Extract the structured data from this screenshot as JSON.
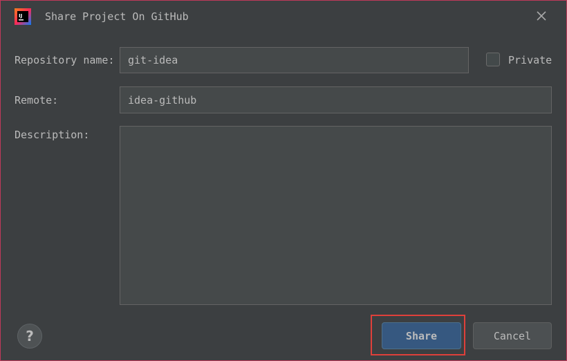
{
  "window": {
    "title": "Share Project On GitHub",
    "app_icon": "intellij-idea-icon",
    "close_icon": "close-icon"
  },
  "form": {
    "repository_name_label": "Repository name:",
    "repository_name_value": "git-idea",
    "private_label": "Private",
    "private_checked": false,
    "remote_label": "Remote:",
    "remote_value": "idea-github",
    "description_label": "Description:",
    "description_value": ""
  },
  "footer": {
    "help_label": "?",
    "share_label": "Share",
    "cancel_label": "Cancel"
  },
  "colors": {
    "background": "#3c3f41",
    "field_background": "#45494a",
    "primary_button": "#365880",
    "highlight": "#e0403a"
  }
}
